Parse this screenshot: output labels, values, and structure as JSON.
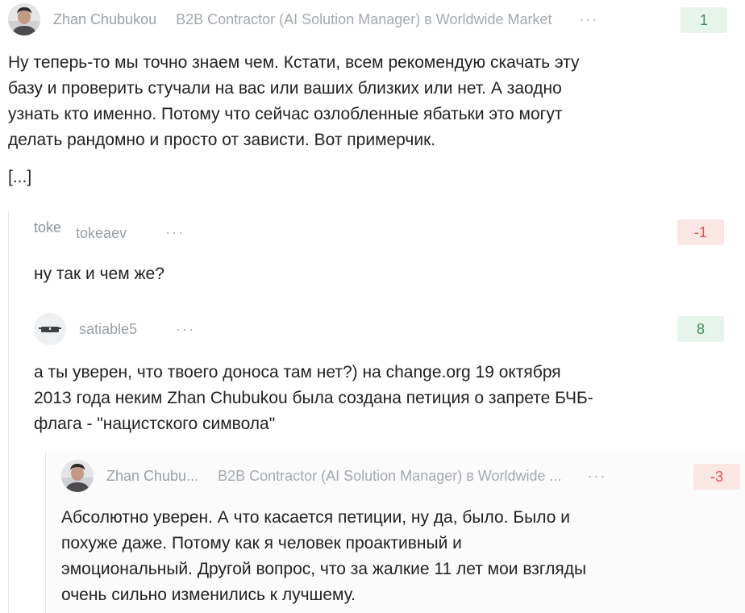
{
  "comments": [
    {
      "username": "Zhan Chubukou",
      "role": "B2B Contractor (AI Solution Manager) в Worldwide Market",
      "more": "···",
      "score": "1",
      "score_color": "#3f8f5d",
      "text_lines": [
        "Ну теперь-то мы точно знаем чем. Кстати, всем рекомендую скачать эту",
        "базу и проверить стучали на вас или ваших близких или нет. А заодно",
        "узнать кто именно. Потому что сейчас озлобленные ябатьки это могут",
        "делать рандомно и просто от зависти. Вот примерчик."
      ],
      "truncated": "[...]"
    },
    {
      "avatar_text": "toke",
      "username": "tokeaev",
      "more": "···",
      "score": "-1",
      "score_color": "#d9534f",
      "text_lines": [
        "ну так и чем же?"
      ]
    },
    {
      "username": "satiable5",
      "more": "···",
      "score": "8",
      "score_color": "#3f8f5d",
      "text_lines": [
        "а ты уверен, что твоего доноса там нет?) на change.org 19 октября",
        "2013 года неким Zhan Chubukou была создана петиция о запрете БЧБ-",
        "флага - \"нацистского символа\""
      ]
    },
    {
      "username": "Zhan Chubu...",
      "role": "B2B Contractor (AI Solution Manager) в Worldwide ...",
      "more": "···",
      "score": "-3",
      "score_color": "#d9534f",
      "text_lines": [
        "Абсолютно уверен. А что касается петиции, ну да, было. Было и",
        "похуже даже. Потому как я человек проактивный и",
        "эмоциональный. Другой вопрос, что за жалкие 11 лет мои взгляды",
        "очень сильно изменились к лучшему."
      ]
    }
  ]
}
